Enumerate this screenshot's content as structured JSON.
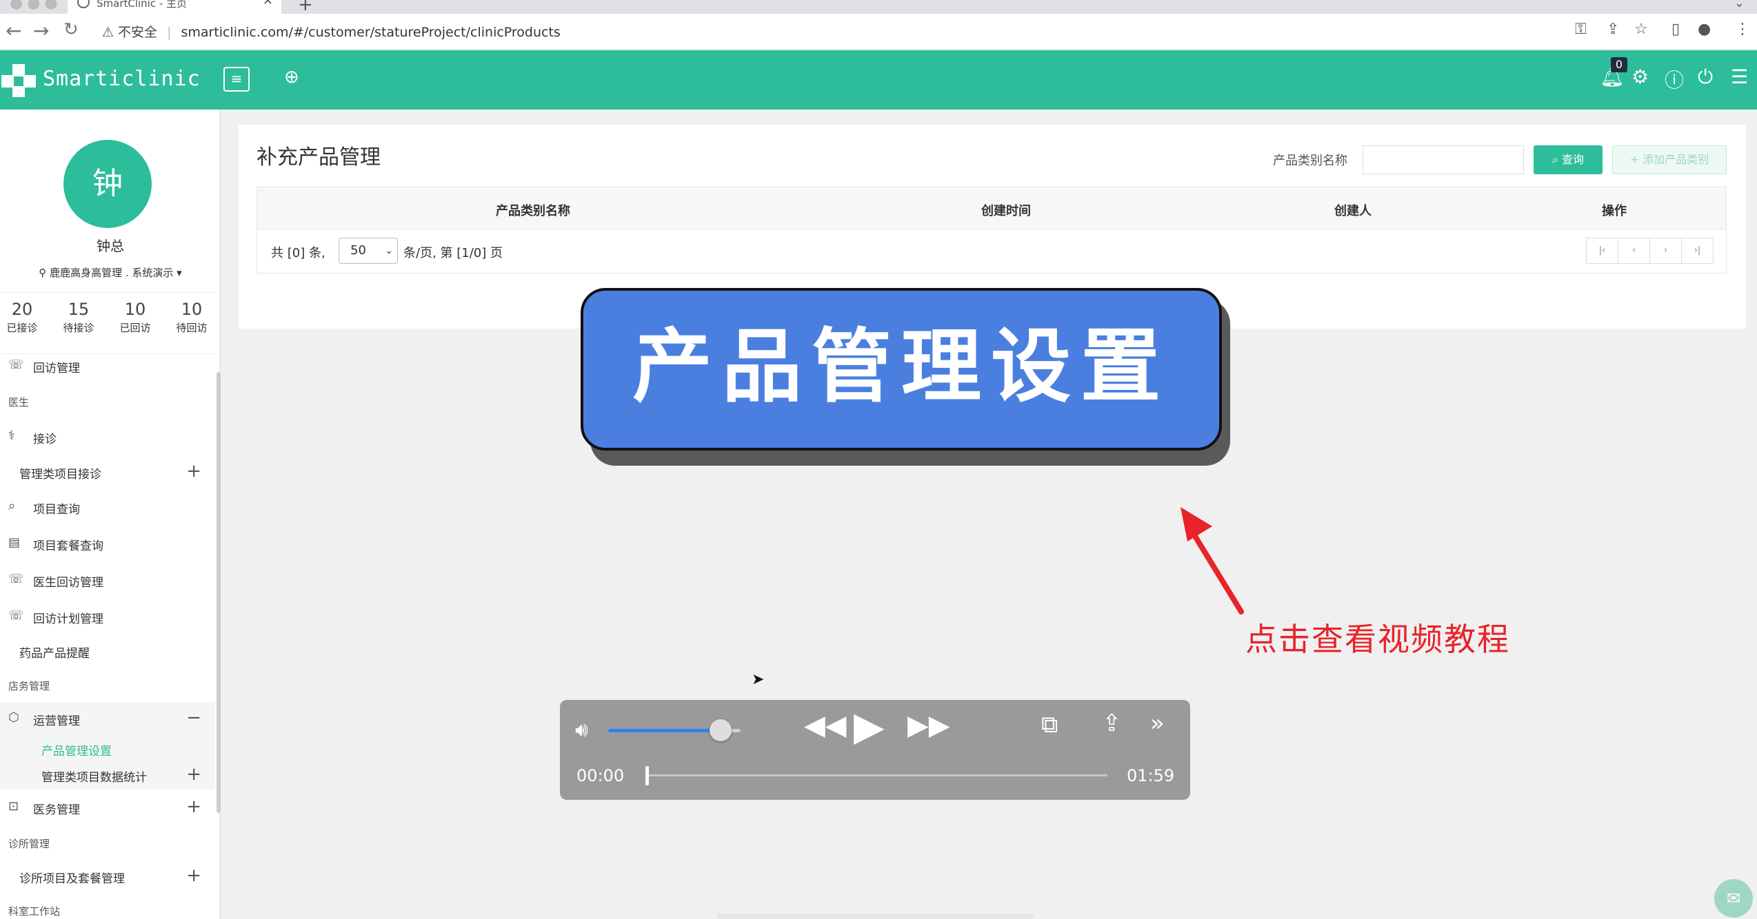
{
  "browser": {
    "tab_title": "SmartClinic - 主页",
    "tab_close": "×",
    "new_tab": "+",
    "insecure_label": "不安全",
    "url": "smarticlinic.com/#/customer/statureProject/clinicProducts"
  },
  "header": {
    "brand": "Smarticlinic",
    "notification_count": "0"
  },
  "user": {
    "avatar_initial": "钟",
    "name": "钟总",
    "org": "鹿鹿高身高管理 . 系统演示"
  },
  "stats": [
    {
      "value": "20",
      "label": "已接诊"
    },
    {
      "value": "15",
      "label": "待接诊"
    },
    {
      "value": "10",
      "label": "已回访"
    },
    {
      "value": "10",
      "label": "待回访"
    }
  ],
  "sidebar": {
    "item_followup": "回访管理",
    "group_doctor": "医生",
    "item_reception": "接诊",
    "item_mgmt_reception": "管理类项目接诊",
    "item_project_query": "项目查询",
    "item_package_query": "项目套餐查询",
    "item_doctor_followup": "医生回访管理",
    "item_followup_plan": "回访计划管理",
    "item_drug_reminder": "药品产品提醒",
    "group_store": "店务管理",
    "item_operations": "运营管理",
    "sub_product_settings": "产品管理设置",
    "sub_mgmt_stats": "管理类项目数据统计",
    "item_medical": "医务管理",
    "group_clinic": "诊所管理",
    "item_clinic_packages": "诊所项目及套餐管理",
    "group_dept": "科室工作站"
  },
  "panel": {
    "title": "补充产品管理",
    "filter_label": "产品类别名称",
    "filter_placeholder": "",
    "query_button": "查询",
    "add_button": "添加产品类别",
    "columns": [
      "产品类别名称",
      "创建时间",
      "创建人",
      "操作"
    ],
    "pager_total": "共 [0] 条,",
    "pager_size": "50",
    "pager_suffix": "条/页,  第 [1/0] 页"
  },
  "overlay": {
    "banner_text": "产品管理设置",
    "hint_text": "点击查看视频教程"
  },
  "video": {
    "current_time": "00:00",
    "duration": "01:59",
    "volume_fraction": 0.85,
    "progress_fraction": 0.0
  },
  "colors": {
    "brand_green": "#2dbd9a",
    "banner_blue": "#4a7fe0",
    "hint_red": "#e8232a"
  }
}
